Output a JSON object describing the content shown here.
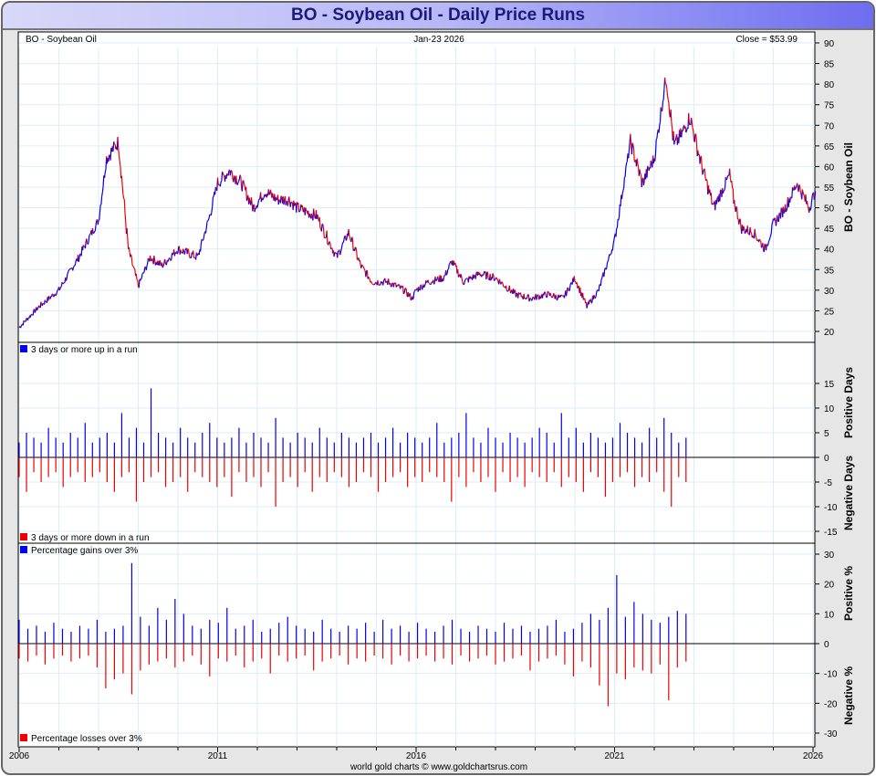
{
  "title": "BO  -  Soybean Oil - Daily Price Runs",
  "footer": "world gold charts © www.goldchartsrus.com",
  "chart_data": [
    {
      "type": "line",
      "name": "price",
      "header_left": "BO  -  Soybean Oil",
      "header_center": "Jan-23  2026",
      "header_right": "Close = $53.99",
      "ylabel": "BO  -  Soybean Oil",
      "ylim": [
        18,
        92
      ],
      "yticks": [
        20,
        25,
        30,
        35,
        40,
        45,
        50,
        55,
        60,
        65,
        70,
        75,
        80,
        85,
        90
      ],
      "x": [
        2006.0,
        2006.5,
        2007.0,
        2007.5,
        2008.0,
        2008.2,
        2008.5,
        2008.75,
        2009.0,
        2009.3,
        2009.6,
        2010.0,
        2010.5,
        2010.8,
        2011.0,
        2011.3,
        2011.6,
        2011.9,
        2012.2,
        2012.5,
        2012.8,
        2013.0,
        2013.5,
        2013.8,
        2014.0,
        2014.3,
        2014.6,
        2014.9,
        2015.3,
        2015.7,
        2015.9,
        2016.0,
        2016.3,
        2016.7,
        2016.9,
        2017.2,
        2017.6,
        2018.0,
        2018.5,
        2018.9,
        2019.3,
        2019.7,
        2020.0,
        2020.3,
        2020.6,
        2021.0,
        2021.4,
        2021.7,
        2022.0,
        2022.3,
        2022.5,
        2022.7,
        2022.9,
        2023.2,
        2023.5,
        2023.9,
        2024.0,
        2024.2,
        2024.5,
        2024.8,
        2025.0,
        2025.3,
        2025.6,
        2025.9,
        2026.06
      ],
      "y": [
        21,
        26,
        30,
        38,
        47,
        62,
        66,
        40,
        31,
        38,
        36,
        40,
        38,
        48,
        56,
        59,
        56,
        50,
        54,
        52,
        52,
        50,
        48,
        42,
        38,
        44,
        36,
        32,
        32,
        30,
        28,
        30,
        32,
        33,
        37,
        32,
        34,
        33,
        29,
        28,
        29,
        28,
        33,
        26,
        30,
        42,
        66,
        56,
        62,
        82,
        65,
        68,
        72,
        60,
        50,
        58,
        52,
        45,
        44,
        40,
        46,
        50,
        56,
        50,
        54
      ]
    },
    {
      "type": "bar",
      "name": "runs",
      "legend_up": "3 days or more up in a run",
      "legend_down": "3 days or more down in a run",
      "ylabel_pos": "Positive Days",
      "ylabel_neg": "Negative Days",
      "ylim": [
        -17,
        17
      ],
      "yticks": [
        15,
        10,
        5,
        0,
        -5,
        -10,
        -15
      ],
      "x_range": [
        2006.0,
        2022.8
      ],
      "up": [
        3,
        5,
        4,
        3,
        6,
        4,
        3,
        5,
        4,
        7,
        3,
        4,
        5,
        3,
        9,
        4,
        6,
        3,
        14,
        5,
        4,
        3,
        6,
        4,
        3,
        5,
        7,
        4,
        3,
        4,
        6,
        3,
        5,
        4,
        3,
        8,
        4,
        3,
        5,
        4,
        3,
        6,
        4,
        3,
        5,
        4,
        3,
        4,
        5,
        3,
        4,
        6,
        3,
        5,
        4,
        3,
        4,
        7,
        3,
        4,
        5,
        9,
        4,
        3,
        6,
        4,
        3,
        5,
        4,
        3,
        4,
        6,
        5,
        3,
        9,
        4,
        6,
        3,
        5,
        4,
        3,
        4,
        7,
        5,
        4,
        3,
        6,
        4,
        8,
        5,
        3,
        4
      ],
      "down": [
        -4,
        -7,
        -3,
        -5,
        -4,
        -3,
        -6,
        -4,
        -3,
        -5,
        -4,
        -3,
        -5,
        -7,
        -4,
        -3,
        -9,
        -5,
        -4,
        -3,
        -6,
        -5,
        -4,
        -7,
        -3,
        -4,
        -5,
        -6,
        -4,
        -8,
        -3,
        -5,
        -4,
        -6,
        -3,
        -10,
        -5,
        -4,
        -6,
        -3,
        -7,
        -4,
        -5,
        -3,
        -4,
        -6,
        -5,
        -3,
        -4,
        -7,
        -5,
        -4,
        -3,
        -6,
        -4,
        -5,
        -3,
        -4,
        -5,
        -9,
        -4,
        -6,
        -3,
        -5,
        -4,
        -7,
        -3,
        -5,
        -4,
        -6,
        -3,
        -4,
        -5,
        -3,
        -6,
        -4,
        -5,
        -7,
        -3,
        -4,
        -8,
        -5,
        -4,
        -3,
        -6,
        -4,
        -5,
        -3,
        -7,
        -10,
        -4,
        -5
      ]
    },
    {
      "type": "bar",
      "name": "percentage",
      "legend_up": "Percentage gains over 3%",
      "legend_down": "Percentage losses over 3%",
      "ylabel_pos": "Positive %",
      "ylabel_neg": "Negative %",
      "ylim": [
        -33,
        33
      ],
      "yticks": [
        30,
        20,
        10,
        0,
        -10,
        -20,
        -30
      ],
      "x_range": [
        2006.0,
        2022.8
      ],
      "up": [
        8,
        5,
        6,
        4,
        7,
        5,
        4,
        6,
        5,
        8,
        4,
        5,
        6,
        27,
        9,
        6,
        12,
        8,
        15,
        10,
        6,
        5,
        8,
        7,
        12,
        5,
        6,
        8,
        4,
        5,
        7,
        9,
        6,
        5,
        4,
        8,
        5,
        4,
        6,
        5,
        7,
        4,
        8,
        5,
        6,
        4,
        7,
        5,
        4,
        6,
        8,
        5,
        4,
        6,
        5,
        4,
        7,
        5,
        6,
        4,
        5,
        6,
        8,
        4,
        5,
        7,
        10,
        8,
        12,
        23,
        9,
        14,
        10,
        8,
        7,
        9,
        11,
        10
      ],
      "down": [
        -5,
        -6,
        -4,
        -7,
        -5,
        -4,
        -6,
        -5,
        -4,
        -8,
        -15,
        -12,
        -10,
        -17,
        -9,
        -7,
        -6,
        -5,
        -8,
        -6,
        -4,
        -7,
        -11,
        -5,
        -6,
        -4,
        -8,
        -6,
        -5,
        -10,
        -4,
        -6,
        -5,
        -4,
        -9,
        -6,
        -5,
        -4,
        -7,
        -5,
        -6,
        -4,
        -5,
        -7,
        -4,
        -6,
        -5,
        -4,
        -6,
        -5,
        -7,
        -4,
        -6,
        -5,
        -4,
        -7,
        -6,
        -5,
        -4,
        -9,
        -6,
        -5,
        -4,
        -7,
        -11,
        -6,
        -8,
        -14,
        -21,
        -10,
        -12,
        -8,
        -9,
        -10,
        -7,
        -19,
        -8,
        -6
      ]
    },
    {
      "type": "axis",
      "xticks": [
        "2006",
        "2011",
        "2016",
        "2021",
        "2026"
      ],
      "xlim": [
        2006.0,
        2026.1
      ]
    }
  ],
  "colors": {
    "up": "#0000ee",
    "down": "#ee0000",
    "grid": "#dcecf8"
  }
}
